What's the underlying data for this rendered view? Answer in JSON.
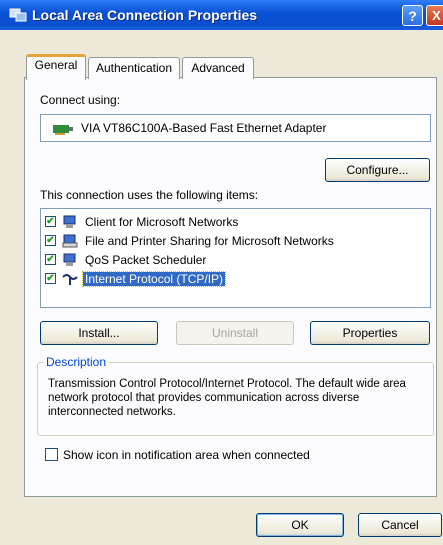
{
  "titlebar": {
    "title": "Local Area Connection Properties",
    "help_label": "?",
    "close_label": "X"
  },
  "tabs": [
    {
      "label": "General",
      "active": true
    },
    {
      "label": "Authentication",
      "active": false
    },
    {
      "label": "Advanced",
      "active": false
    }
  ],
  "connect_using": {
    "label": "Connect using:",
    "adapter": "VIA VT86C100A-Based Fast Ethernet Adapter",
    "configure_label": "Configure..."
  },
  "items_section": {
    "label": "This connection uses the following items:",
    "items": [
      {
        "label": "Client for Microsoft Networks",
        "checked": true,
        "selected": false,
        "icon": "client-icon"
      },
      {
        "label": "File and Printer Sharing for Microsoft Networks",
        "checked": true,
        "selected": false,
        "icon": "sharing-icon"
      },
      {
        "label": "QoS Packet Scheduler",
        "checked": true,
        "selected": false,
        "icon": "scheduler-icon"
      },
      {
        "label": "Internet Protocol (TCP/IP)",
        "checked": true,
        "selected": true,
        "icon": "protocol-icon"
      }
    ]
  },
  "buttons": {
    "install": "Install...",
    "uninstall": "Uninstall",
    "properties": "Properties"
  },
  "description": {
    "legend": "Description",
    "text": "Transmission Control Protocol/Internet Protocol. The default wide area network protocol that provides communication across diverse interconnected networks."
  },
  "show_icon": {
    "label": "Show icon in notification area when connected",
    "checked": false
  },
  "footer": {
    "ok": "OK",
    "cancel": "Cancel"
  },
  "colors": {
    "titlebar": "#0b4fcf",
    "dialog_bg": "#ece9d8",
    "selection": "#316ac5",
    "legend": "#0046d5"
  }
}
